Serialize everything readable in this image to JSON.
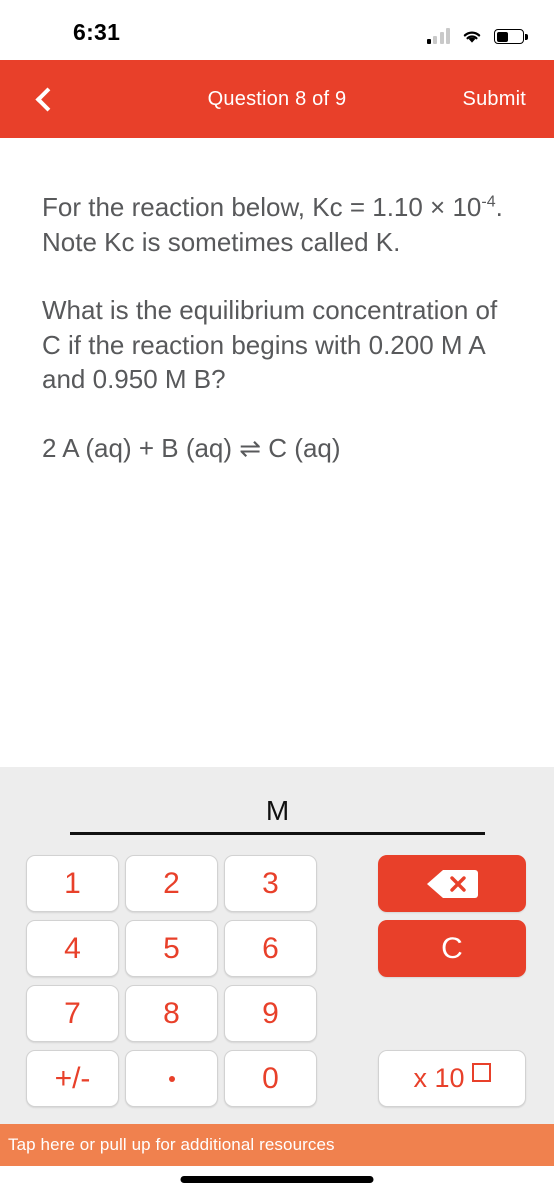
{
  "status_bar": {
    "time": "6:31",
    "signal_icon": "cellular-signal-icon",
    "wifi_icon": "wifi-icon",
    "battery_icon": "battery-icon"
  },
  "nav": {
    "back_icon": "back-chevron-icon",
    "title": "Question 8 of 9",
    "submit_label": "Submit",
    "background_color": "#E8402A"
  },
  "question": {
    "paragraph_1_before": "For the reaction below, Kc = 1.10 × 10",
    "paragraph_1_exponent": "-4",
    "paragraph_1_after": ". Note Kc is sometimes called K.",
    "paragraph_2": "What is the equilibrium concentration of C if the reaction begins with 0.200 M A and 0.950 M B?",
    "equation": "2 A (aq) + B (aq) ⇌ C (aq)"
  },
  "answer": {
    "value": "",
    "unit": "M"
  },
  "keypad": {
    "keys": [
      {
        "label": "1",
        "name": "key-1"
      },
      {
        "label": "2",
        "name": "key-2"
      },
      {
        "label": "3",
        "name": "key-3"
      },
      {
        "label": "4",
        "name": "key-4"
      },
      {
        "label": "5",
        "name": "key-5"
      },
      {
        "label": "6",
        "name": "key-6"
      },
      {
        "label": "7",
        "name": "key-7"
      },
      {
        "label": "8",
        "name": "key-8"
      },
      {
        "label": "9",
        "name": "key-9"
      },
      {
        "label": "+/-",
        "name": "key-sign"
      },
      {
        "label": ".",
        "name": "key-decimal"
      },
      {
        "label": "0",
        "name": "key-0"
      }
    ],
    "backspace_icon": "backspace-icon",
    "clear_label": "C",
    "exponent_label": "x 10",
    "key_text_color": "#E8402A",
    "action_bg_color": "#E8402A",
    "panel_bg_color": "#EDEDED"
  },
  "resources_bar": {
    "label": "Tap here or pull up for additional resources",
    "background_color": "#F0814E"
  }
}
